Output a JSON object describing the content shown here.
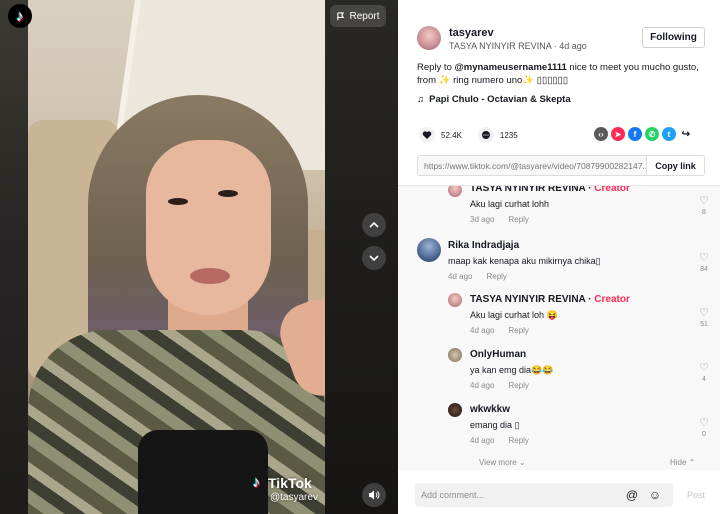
{
  "video": {
    "report_label": "Report",
    "watermark_brand": "TikTok",
    "watermark_user": "@tasyarev"
  },
  "post": {
    "username": "tasyarev",
    "display_name": "TASYA NYINYIR REVINA",
    "age": "4d ago",
    "follow_label": "Following",
    "caption_prefix": "Reply to ",
    "caption_mention": "@mynameusername1111",
    "caption_rest": " nice to meet you mucho gusto, from ✨ ring numero uno✨ ▯▯▯▯▯▯",
    "music": "Papi Chulo - Octavian & Skepta",
    "likes": "52.4K",
    "comments": "1235",
    "link": "https://www.tiktok.com/@tasyarev/video/70879900282147...",
    "copy_label": "Copy link"
  },
  "comments": [
    {
      "name": "TASYA NYINYIR REVINA",
      "creator": "Creator",
      "text": "Aku lagi curhat lohh",
      "time": "3d ago",
      "reply": "Reply",
      "likes": "8"
    },
    {
      "name": "Rika Indradjaja",
      "creator": "",
      "text": "maap kak kenapa aku mikirnya chika▯",
      "time": "4d ago",
      "reply": "Reply",
      "likes": "84"
    },
    {
      "name": "TASYA NYINYIR REVINA",
      "creator": "Creator",
      "text": "Aku lagi curhat loh 😝",
      "time": "4d ago",
      "reply": "Reply",
      "likes": "51"
    },
    {
      "name": "OnlyHuman",
      "creator": "",
      "text": "ya kan emg dia😂😂",
      "time": "4d ago",
      "reply": "Reply",
      "likes": "4"
    },
    {
      "name": "wkwkkw",
      "creator": "",
      "text": "emang dia ▯",
      "time": "4d ago",
      "reply": "Reply",
      "likes": "0"
    }
  ],
  "view_more": "View more",
  "hide": "Hide",
  "add_comment_placeholder": "Add comment...",
  "post_label": "Post",
  "colors": {
    "accent": "#fe2c55",
    "link_blue": "#161823"
  }
}
